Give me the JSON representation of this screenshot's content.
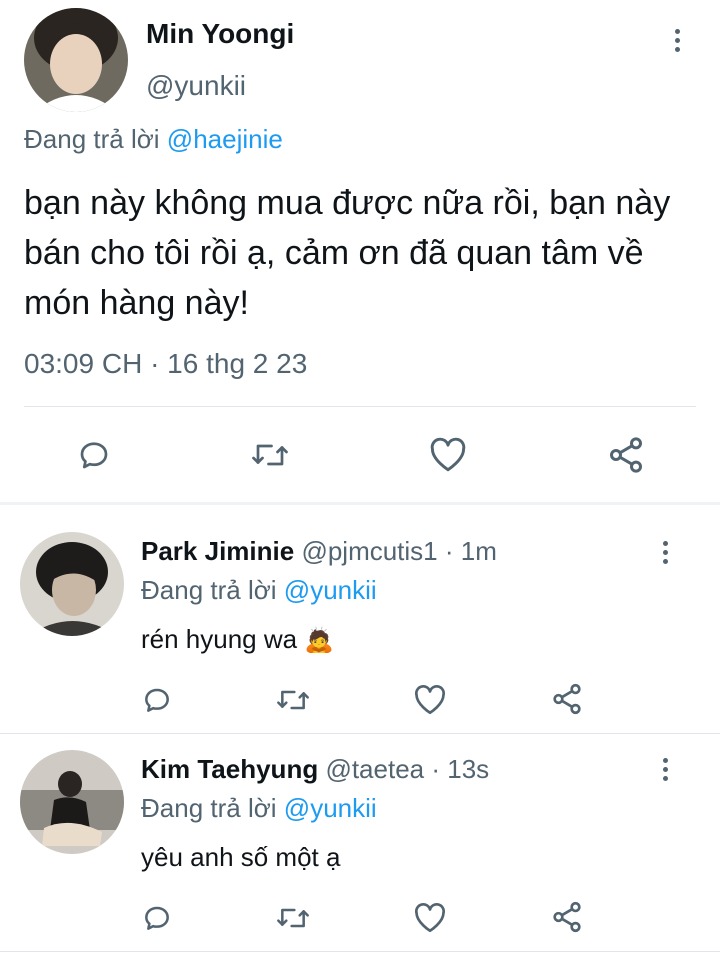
{
  "main_tweet": {
    "name": "Min Yoongi",
    "handle": "@yunkii",
    "replying_prefix": "Đang trả lời",
    "replying_to": "@haejinie",
    "text": "bạn này không mua được nữa rồi, bạn này bán cho tôi rồi ạ, cảm ơn đã quan tâm về món hàng này!",
    "timestamp": "03:09 CH · 16 thg 2 23"
  },
  "replies": [
    {
      "name": "Park Jiminie",
      "handle": "@pjmcutis1",
      "time": "· 1m",
      "replying_prefix": "Đang trả lời",
      "replying_to": "@yunkii",
      "text": "rén hyung wa",
      "emoji": "🙇"
    },
    {
      "name": "Kim Taehyung",
      "handle": "@taetea",
      "time": "· 13s",
      "replying_prefix": "Đang trả lời",
      "replying_to": "@yunkii",
      "text": "yêu anh số một ạ"
    }
  ],
  "icons": [
    "reply-icon",
    "retweet-icon",
    "like-icon",
    "share-icon",
    "more-icon"
  ],
  "colors": {
    "link": "#1d9bf0",
    "secondary": "#536471",
    "text": "#0f1419"
  }
}
